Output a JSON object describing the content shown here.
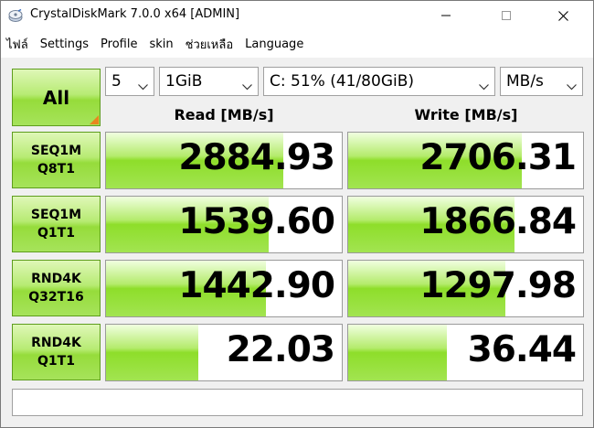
{
  "window": {
    "title": "CrystalDiskMark 7.0.0 x64 [ADMIN]"
  },
  "menu": [
    {
      "label": "ไฟล์"
    },
    {
      "label": "Settings"
    },
    {
      "label": "Profile"
    },
    {
      "label": "skin"
    },
    {
      "label": "ช่วยเหลือ"
    },
    {
      "label": "Language"
    }
  ],
  "controls": {
    "all_button": "All",
    "count": "5",
    "size": "1GiB",
    "drive": "C: 51% (41/80GiB)",
    "unit": "MB/s"
  },
  "headers": {
    "read": "Read [MB/s]",
    "write": "Write [MB/s]"
  },
  "tests": [
    {
      "line1": "SEQ1M",
      "line2": "Q8T1",
      "read": "2884.93",
      "write": "2706.31",
      "read_fill": 0.75,
      "write_fill": 0.74
    },
    {
      "line1": "SEQ1M",
      "line2": "Q1T1",
      "read": "1539.60",
      "write": "1866.84",
      "read_fill": 0.69,
      "write_fill": 0.71
    },
    {
      "line1": "RND4K",
      "line2": "Q32T16",
      "read": "1442.90",
      "write": "1297.98",
      "read_fill": 0.68,
      "write_fill": 0.67
    },
    {
      "line1": "RND4K",
      "line2": "Q1T1",
      "read": "22.03",
      "write": "36.44",
      "read_fill": 0.39,
      "write_fill": 0.42
    }
  ],
  "status": "",
  "colors": {
    "accent_green": "#96dc3b",
    "corner_orange": "#e8861e"
  },
  "icons": {
    "app": "crystaldiskmark-icon",
    "minimize": "minimize-icon",
    "maximize": "maximize-icon",
    "close": "close-icon",
    "dropdown": "chevron-down-icon"
  }
}
